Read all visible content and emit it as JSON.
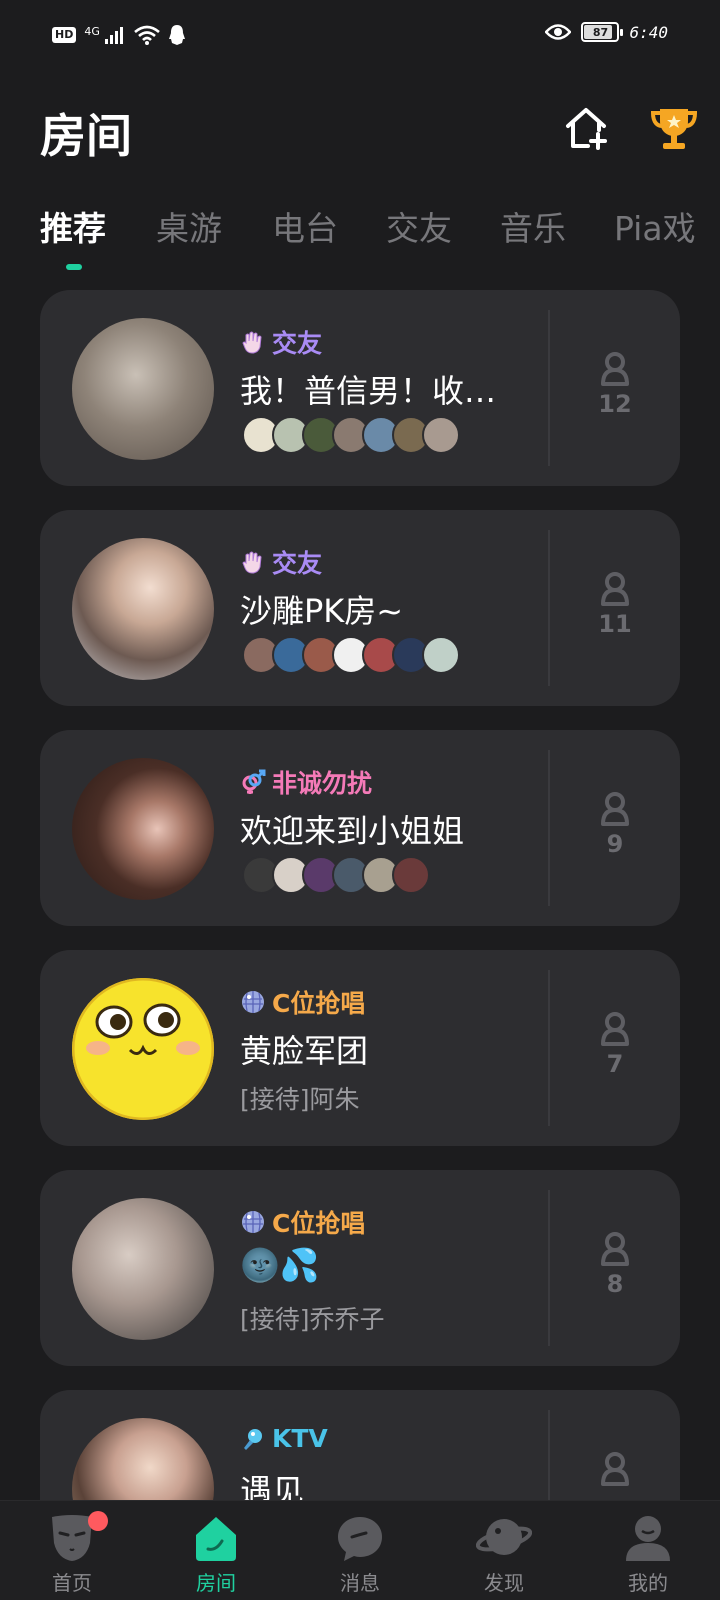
{
  "status_bar": {
    "hd": "HD",
    "network": "4G",
    "battery": "87",
    "battery_level": 0.87,
    "time": "6:40"
  },
  "header": {
    "title": "房间",
    "create_icon": "home-plus-icon",
    "trophy_icon": "trophy-icon",
    "trophy_color": "#f5a623"
  },
  "tabs": [
    {
      "label": "推荐",
      "active": true
    },
    {
      "label": "桌游"
    },
    {
      "label": "电台"
    },
    {
      "label": "交友"
    },
    {
      "label": "音乐"
    },
    {
      "label": "Pia戏"
    }
  ],
  "accent_color": "#1fd1a0",
  "rooms": [
    {
      "category": "交友",
      "category_icon": "waving-hand-icon",
      "category_color": "#a98bf5",
      "title": "我！普信男！收…",
      "count": "12"
    },
    {
      "category": "交友",
      "category_icon": "waving-hand-icon",
      "category_color": "#a98bf5",
      "title": "沙雕PK房~",
      "count": "11"
    },
    {
      "category": "非诚勿扰",
      "category_icon": "gender-icon",
      "category_color": "#f57ab8",
      "title": "欢迎来到小姐姐",
      "count": "9"
    },
    {
      "category": "C位抢唱",
      "category_icon": "disco-ball-icon",
      "category_color": "#f5a94a",
      "title": "黄脸军团",
      "host": "[接待]阿朱",
      "count": "7"
    },
    {
      "category": "C位抢唱",
      "category_icon": "disco-ball-icon",
      "category_color": "#f5a94a",
      "title": "🌚💦",
      "host": "[接待]乔乔子",
      "count": "8"
    },
    {
      "category": "KTV",
      "category_icon": "microphone-icon",
      "category_color": "#4ac3e8",
      "title": "遇见",
      "count": ""
    }
  ],
  "nav": [
    {
      "label": "首页",
      "icon": "mask-icon"
    },
    {
      "label": "房间",
      "icon": "room-icon",
      "active": true
    },
    {
      "label": "消息",
      "icon": "chat-bubble-icon"
    },
    {
      "label": "发现",
      "icon": "planet-icon"
    },
    {
      "label": "我的",
      "icon": "profile-icon"
    }
  ]
}
